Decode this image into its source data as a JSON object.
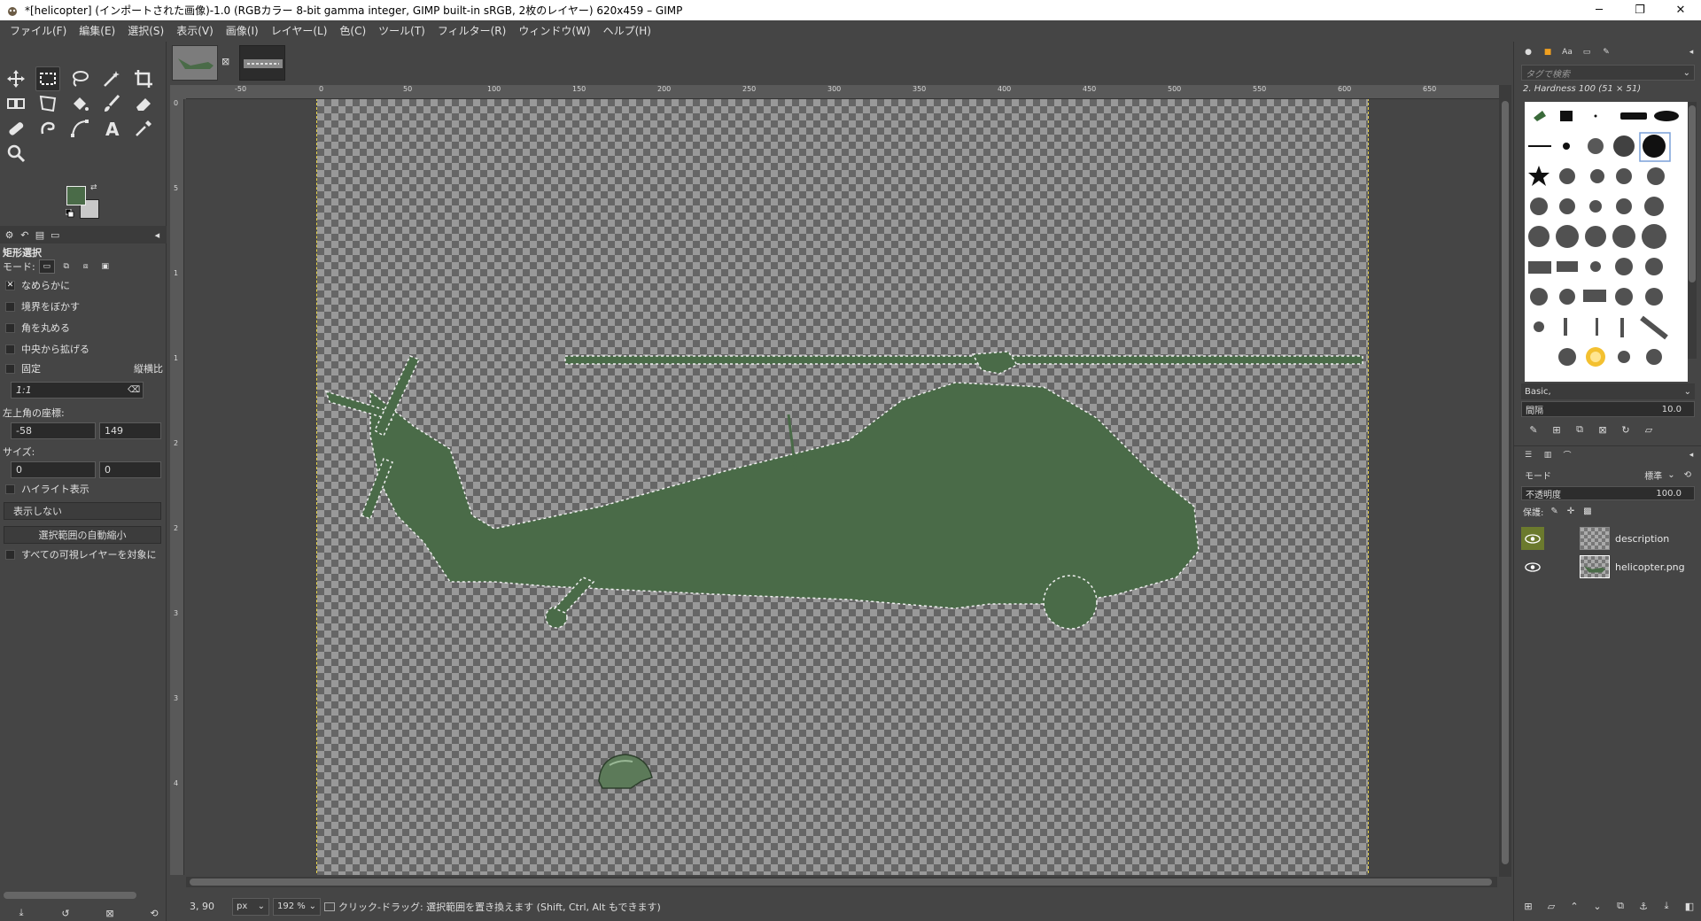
{
  "window": {
    "title": "*[helicopter] (インポートされた画像)-1.0 (RGBカラー 8-bit gamma integer, GIMP built-in sRGB, 2枚のレイヤー) 620x459 – GIMP",
    "minimize": "─",
    "maximize": "❐",
    "close": "✕"
  },
  "menubar": {
    "items": [
      "ファイル(F)",
      "編集(E)",
      "選択(S)",
      "表示(V)",
      "画像(I)",
      "レイヤー(L)",
      "色(C)",
      "ツール(T)",
      "フィルター(R)",
      "ウィンドウ(W)",
      "ヘルプ(H)"
    ]
  },
  "colors": {
    "foreground": "#4a6b48",
    "background": "#c8c8c8",
    "helicopter": "#4a6b48",
    "selection_outline": "#e8d34a"
  },
  "tools": [
    {
      "name": "move-tool-icon"
    },
    {
      "name": "rect-select-tool-icon",
      "active": true
    },
    {
      "name": "lasso-tool-icon"
    },
    {
      "name": "fuzzy-select-tool-icon"
    },
    {
      "name": "crop-tool-icon"
    },
    {
      "name": "unified-transform-tool-icon"
    },
    {
      "name": "warp-transform-tool-icon"
    },
    {
      "name": "bucket-fill-tool-icon"
    },
    {
      "name": "paintbrush-tool-icon"
    },
    {
      "name": "eraser-tool-icon"
    },
    {
      "name": "heal-tool-icon"
    },
    {
      "name": "smudge-tool-icon"
    },
    {
      "name": "paths-tool-icon"
    },
    {
      "name": "text-tool-icon"
    },
    {
      "name": "color-picker-tool-icon"
    },
    {
      "name": "zoom-tool-icon"
    }
  ],
  "tool_options": {
    "title": "矩形選択",
    "mode_label": "モード:",
    "antialias": "なめらかに",
    "feather": "境界をぼかす",
    "rounded": "角を丸める",
    "expand_center": "中央から拡げる",
    "fixed": "固定",
    "fixed_type": "縦横比",
    "ratio": "1:1",
    "position_label": "左上角の座標:",
    "pos_x": "-58",
    "pos_y": "149",
    "unit": "px",
    "size_label": "サイズ:",
    "size_w": "0",
    "size_h": "0",
    "highlight": "ハイライト表示",
    "guides": "表示しない",
    "autoshrink": "選択範囲の自動縮小",
    "shrink_merged": "すべての可視レイヤーを対象に"
  },
  "ruler": {
    "h_labels": [
      "-50",
      "0",
      "50",
      "100",
      "150",
      "200",
      "250",
      "300",
      "350",
      "400",
      "450",
      "500",
      "550",
      "600",
      "650"
    ],
    "v_labels": [
      "0",
      "5",
      "1",
      "1",
      "2",
      "2",
      "3",
      "3",
      "4"
    ]
  },
  "status": {
    "coords": "3, 90",
    "unit": "px",
    "zoom": "192 %",
    "message": "クリック-ドラッグ: 選択範囲を置き換えます (Shift, Ctrl, Alt もできます)"
  },
  "brushes": {
    "search_placeholder": "タグで検索",
    "current": "2. Hardness 100 (51 × 51)",
    "preset": "Basic,",
    "spacing_label": "間隔",
    "spacing_value": "10.0"
  },
  "layers": {
    "mode_label": "モード",
    "mode_value": "標準",
    "opacity_label": "不透明度",
    "opacity_value": "100.0",
    "lock_label": "保護:",
    "items": [
      {
        "name": "description"
      },
      {
        "name": "helicopter.png"
      }
    ]
  }
}
